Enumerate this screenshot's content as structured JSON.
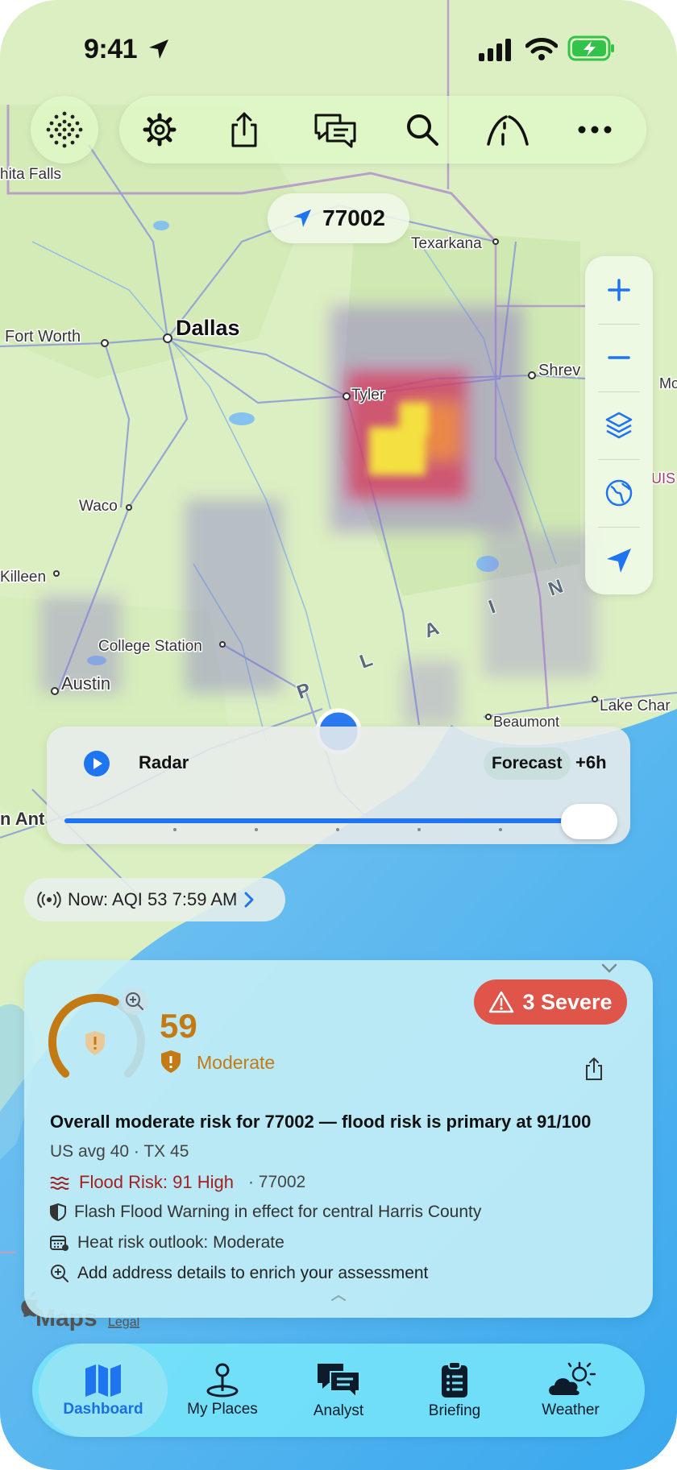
{
  "status_bar": {
    "time": "9:41"
  },
  "toolbar": {
    "icons": [
      "dots-grid-icon",
      "gear-icon",
      "share-icon",
      "chat-icon",
      "search-icon",
      "road-icon",
      "more-icon"
    ]
  },
  "location_pill": {
    "label": "77002"
  },
  "map": {
    "labels": {
      "wichita_falls": "hita Falls",
      "texarkana": "Texarkana",
      "fort_worth": "Fort Worth",
      "dallas": "Dallas",
      "shreveport": "Shrev",
      "mo": "Mo",
      "tyler": "Tyler",
      "uis": "UIS",
      "waco": "Waco",
      "killeen": "Killeen",
      "college_station": "College Station",
      "austin": "Austin",
      "lake_charles": "Lake Char",
      "beaumont": "Beaumont",
      "san_antonio": "n Ant",
      "plain_p": "P",
      "plain_l": "L",
      "plain_a": "A",
      "plain_i": "I",
      "plain_n": "N"
    },
    "attribution": "Maps",
    "legal": "Legal"
  },
  "side_controls": {
    "icons": [
      "plus-icon",
      "minus-icon",
      "layers-icon",
      "globe-icon",
      "location-arrow-icon"
    ]
  },
  "radar": {
    "label": "Radar",
    "forecast_label": "Forecast",
    "forecast_offset": "+6h",
    "slider_value": 1.0
  },
  "aqi_now": {
    "text": "Now: AQI 53 7:59 AM"
  },
  "risk_card": {
    "score": "59",
    "level": "Moderate",
    "gauge_fraction": 0.59,
    "severe_badge": "3 Severe",
    "headline": "Overall moderate risk for 77002 — flood risk is primary at 91/100",
    "comparison": "US avg 40 · TX 45",
    "flood_label": "Flood Risk: 91 High",
    "flood_zip": "· 77002",
    "warning": "Flash Flood Warning in effect for central Harris County",
    "heat": "Heat risk outlook: Moderate",
    "enrich": "Add address details to enrich your assessment",
    "colors": {
      "score": "#c47a14",
      "flood": "#a32020",
      "severe": "#e0554a"
    }
  },
  "tabs": [
    {
      "label": "Dashboard",
      "icon": "map-icon",
      "active": true
    },
    {
      "label": "My Places",
      "icon": "pin-icon",
      "active": false
    },
    {
      "label": "Analyst",
      "icon": "chat-icon",
      "active": false
    },
    {
      "label": "Briefing",
      "icon": "clipboard-icon",
      "active": false
    },
    {
      "label": "Weather",
      "icon": "cloud-sun-icon",
      "active": false
    }
  ]
}
